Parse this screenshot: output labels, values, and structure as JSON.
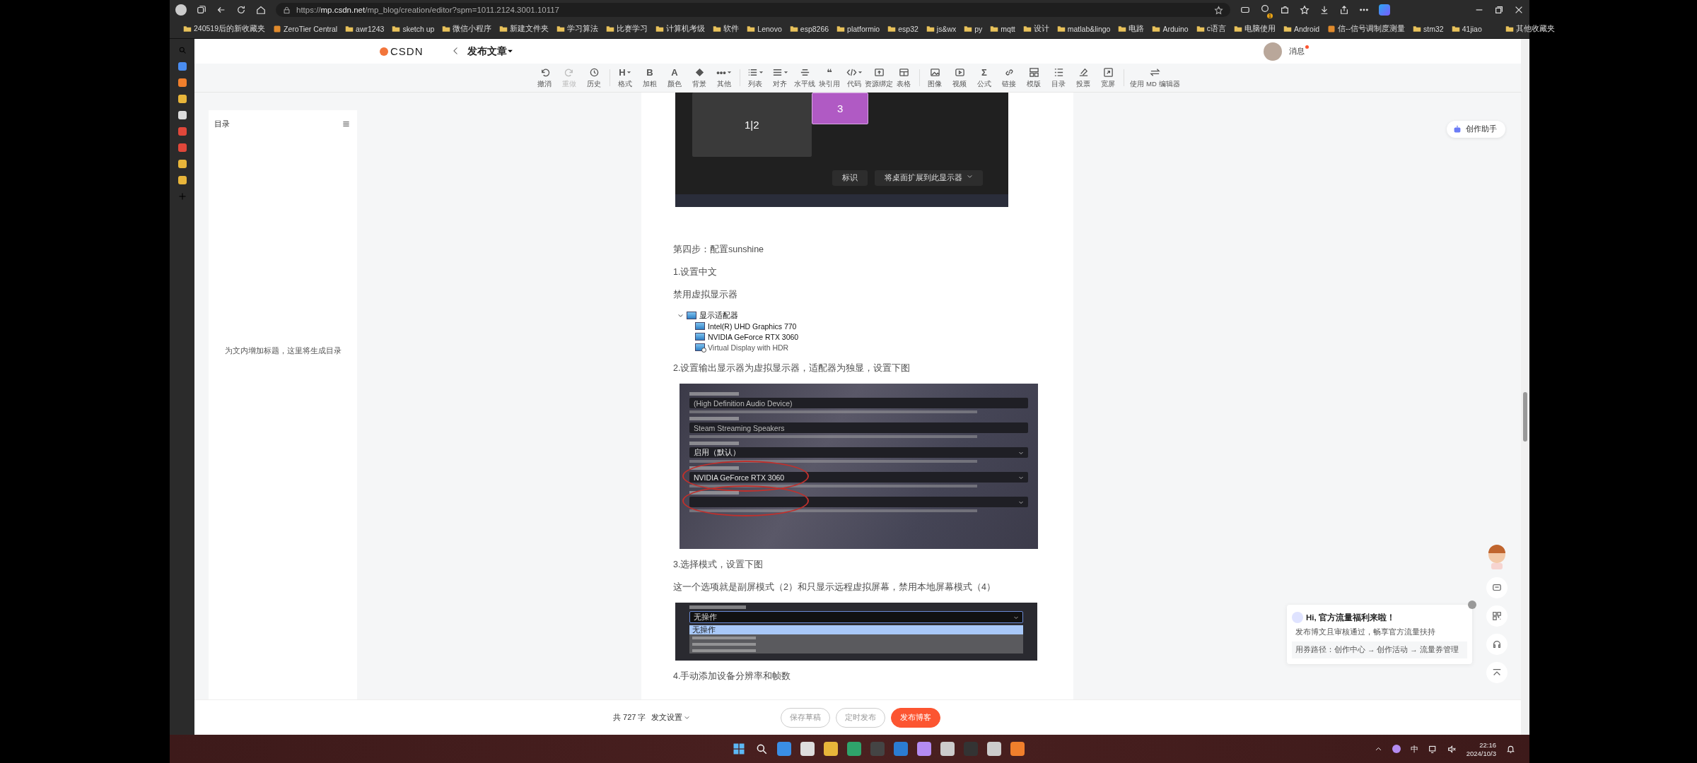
{
  "browser": {
    "url_scheme": "https://",
    "url_host": "mp.csdn.net",
    "url_path": "/mp_blog/creation/editor?spm=1011.2124.3001.10117",
    "extension_badge": "1",
    "bookmarks": [
      {
        "label": "240519后的新收藏夹",
        "kind": "folder"
      },
      {
        "label": "ZeroTier Central",
        "kind": "site"
      },
      {
        "label": "awr1243",
        "kind": "folder"
      },
      {
        "label": "sketch up",
        "kind": "folder"
      },
      {
        "label": "微信小程序",
        "kind": "folder"
      },
      {
        "label": "新建文件夹",
        "kind": "folder"
      },
      {
        "label": "学习算法",
        "kind": "folder"
      },
      {
        "label": "比赛学习",
        "kind": "folder"
      },
      {
        "label": "计算机考级",
        "kind": "folder"
      },
      {
        "label": "软件",
        "kind": "folder"
      },
      {
        "label": "Lenovo",
        "kind": "folder"
      },
      {
        "label": "esp8266",
        "kind": "folder"
      },
      {
        "label": "platformio",
        "kind": "folder"
      },
      {
        "label": "esp32",
        "kind": "folder"
      },
      {
        "label": "js&wx",
        "kind": "folder"
      },
      {
        "label": "py",
        "kind": "folder"
      },
      {
        "label": "mqtt",
        "kind": "folder"
      },
      {
        "label": "设计",
        "kind": "folder"
      },
      {
        "label": "matlab&lingo",
        "kind": "folder"
      },
      {
        "label": "电路",
        "kind": "folder"
      },
      {
        "label": "Arduino",
        "kind": "folder"
      },
      {
        "label": "c语言",
        "kind": "folder"
      },
      {
        "label": "电脑使用",
        "kind": "folder"
      },
      {
        "label": "Android",
        "kind": "folder"
      },
      {
        "label": "信--信号调制度测量",
        "kind": "site"
      },
      {
        "label": "stm32",
        "kind": "folder"
      },
      {
        "label": "41jiao",
        "kind": "folder"
      }
    ],
    "other_bookmarks": "其他收藏夹"
  },
  "header": {
    "logo": "CSDN",
    "title": "发布文章",
    "messages": "消息",
    "unread": true
  },
  "toolbar": [
    [
      {
        "label": "撤消",
        "disabled": false
      },
      {
        "label": "重做",
        "disabled": true
      },
      {
        "label": "历史",
        "disabled": false
      }
    ],
    [
      {
        "label": "格式",
        "glyph": "H",
        "menu": true
      },
      {
        "label": "加粗",
        "glyph": "B",
        "menu": false
      },
      {
        "label": "颜色",
        "glyph": "A",
        "menu": false
      },
      {
        "label": "背景",
        "menu": false
      },
      {
        "label": "其他",
        "glyph": "•••",
        "menu": true
      }
    ],
    [
      {
        "label": "列表",
        "menu": true
      },
      {
        "label": "对齐",
        "menu": true
      },
      {
        "label": "水平线",
        "menu": false
      },
      {
        "label": "块引用",
        "glyph": "❝",
        "menu": false
      },
      {
        "label": "代码",
        "menu": true
      },
      {
        "label": "资源绑定",
        "menu": false
      },
      {
        "label": "表格",
        "menu": false
      }
    ],
    [
      {
        "label": "图像",
        "menu": false
      },
      {
        "label": "视频",
        "menu": false
      },
      {
        "label": "公式",
        "glyph": "Σ",
        "menu": false
      },
      {
        "label": "链接",
        "menu": false
      },
      {
        "label": "模版",
        "menu": false
      },
      {
        "label": "目录",
        "menu": false
      },
      {
        "label": "投票",
        "menu": false
      },
      {
        "label": "宽屏",
        "menu": false
      }
    ],
    [
      {
        "label": "使用 MD 编辑器",
        "menu": false
      }
    ]
  ],
  "toc": {
    "title": "目录",
    "placeholder": "为文内增加标题，这里将生成目录"
  },
  "assistant": "创作助手",
  "doc": [
    {
      "kind": "display_settings",
      "monitors": [
        {
          "label": "1|2",
          "selected": false
        },
        {
          "label": "3",
          "selected": true
        }
      ],
      "buttons": [
        {
          "label": "标识",
          "menu": false
        },
        {
          "label": "将桌面扩展到此显示器",
          "menu": true
        }
      ]
    },
    {
      "kind": "text",
      "text": "第四步：配置sunshine"
    },
    {
      "kind": "text",
      "text": "1.设置中文"
    },
    {
      "kind": "text",
      "text": "禁用虚拟显示器"
    },
    {
      "kind": "device_tree",
      "root": {
        "label": "显示适配器",
        "expanded": true,
        "children": [
          {
            "label": "Intel(R) UHD Graphics 770",
            "disabled": false
          },
          {
            "label": "NVIDIA GeForce RTX 3060",
            "disabled": false
          },
          {
            "label": "Virtual Display with HDR",
            "disabled": true
          }
        ]
      }
    },
    {
      "kind": "text",
      "text": "2.设置输出显示器为虚拟显示器，适配器为独显，设置下图"
    },
    {
      "kind": "settings_form",
      "fields": [
        {
          "kind": "input",
          "value": "(High Definition Audio Device)",
          "circled": false
        },
        {
          "kind": "input",
          "value": "Steam Streaming Speakers",
          "circled": false
        },
        {
          "kind": "select",
          "value": "启用（默认）",
          "circled": false
        },
        {
          "kind": "select",
          "value": "NVIDIA GeForce RTX 3060",
          "circled": true
        },
        {
          "kind": "select",
          "circled": true
        }
      ]
    },
    {
      "kind": "text",
      "text": "3.选择模式，设置下图"
    },
    {
      "kind": "text",
      "text": "这一个选项就是副屏模式（2）和只显示远程虚拟屏幕，禁用本地屏幕模式（4）"
    },
    {
      "kind": "dropdown",
      "value": "无操作",
      "options": [
        {
          "label": "无操作",
          "selected": true
        }
      ]
    },
    {
      "kind": "text",
      "text": "4.手动添加设备分辨率和帧数"
    }
  ],
  "promo": {
    "title": "Hi, 官方流量福利来啦！",
    "body": "发布博文且审核通过，畅享官方流量扶持",
    "path": "用券路径：创作中心 → 创作活动 → 流量券管理"
  },
  "footer": {
    "word_count": "共 727 字",
    "settings": "发文设置",
    "buttons": [
      {
        "label": "保存草稿",
        "kind": "outline"
      },
      {
        "label": "定时发布",
        "kind": "outline"
      },
      {
        "label": "发布博客",
        "kind": "primary"
      }
    ]
  },
  "taskbar": {
    "ime": "中",
    "time": "22:16",
    "date": "2024/10/3"
  }
}
